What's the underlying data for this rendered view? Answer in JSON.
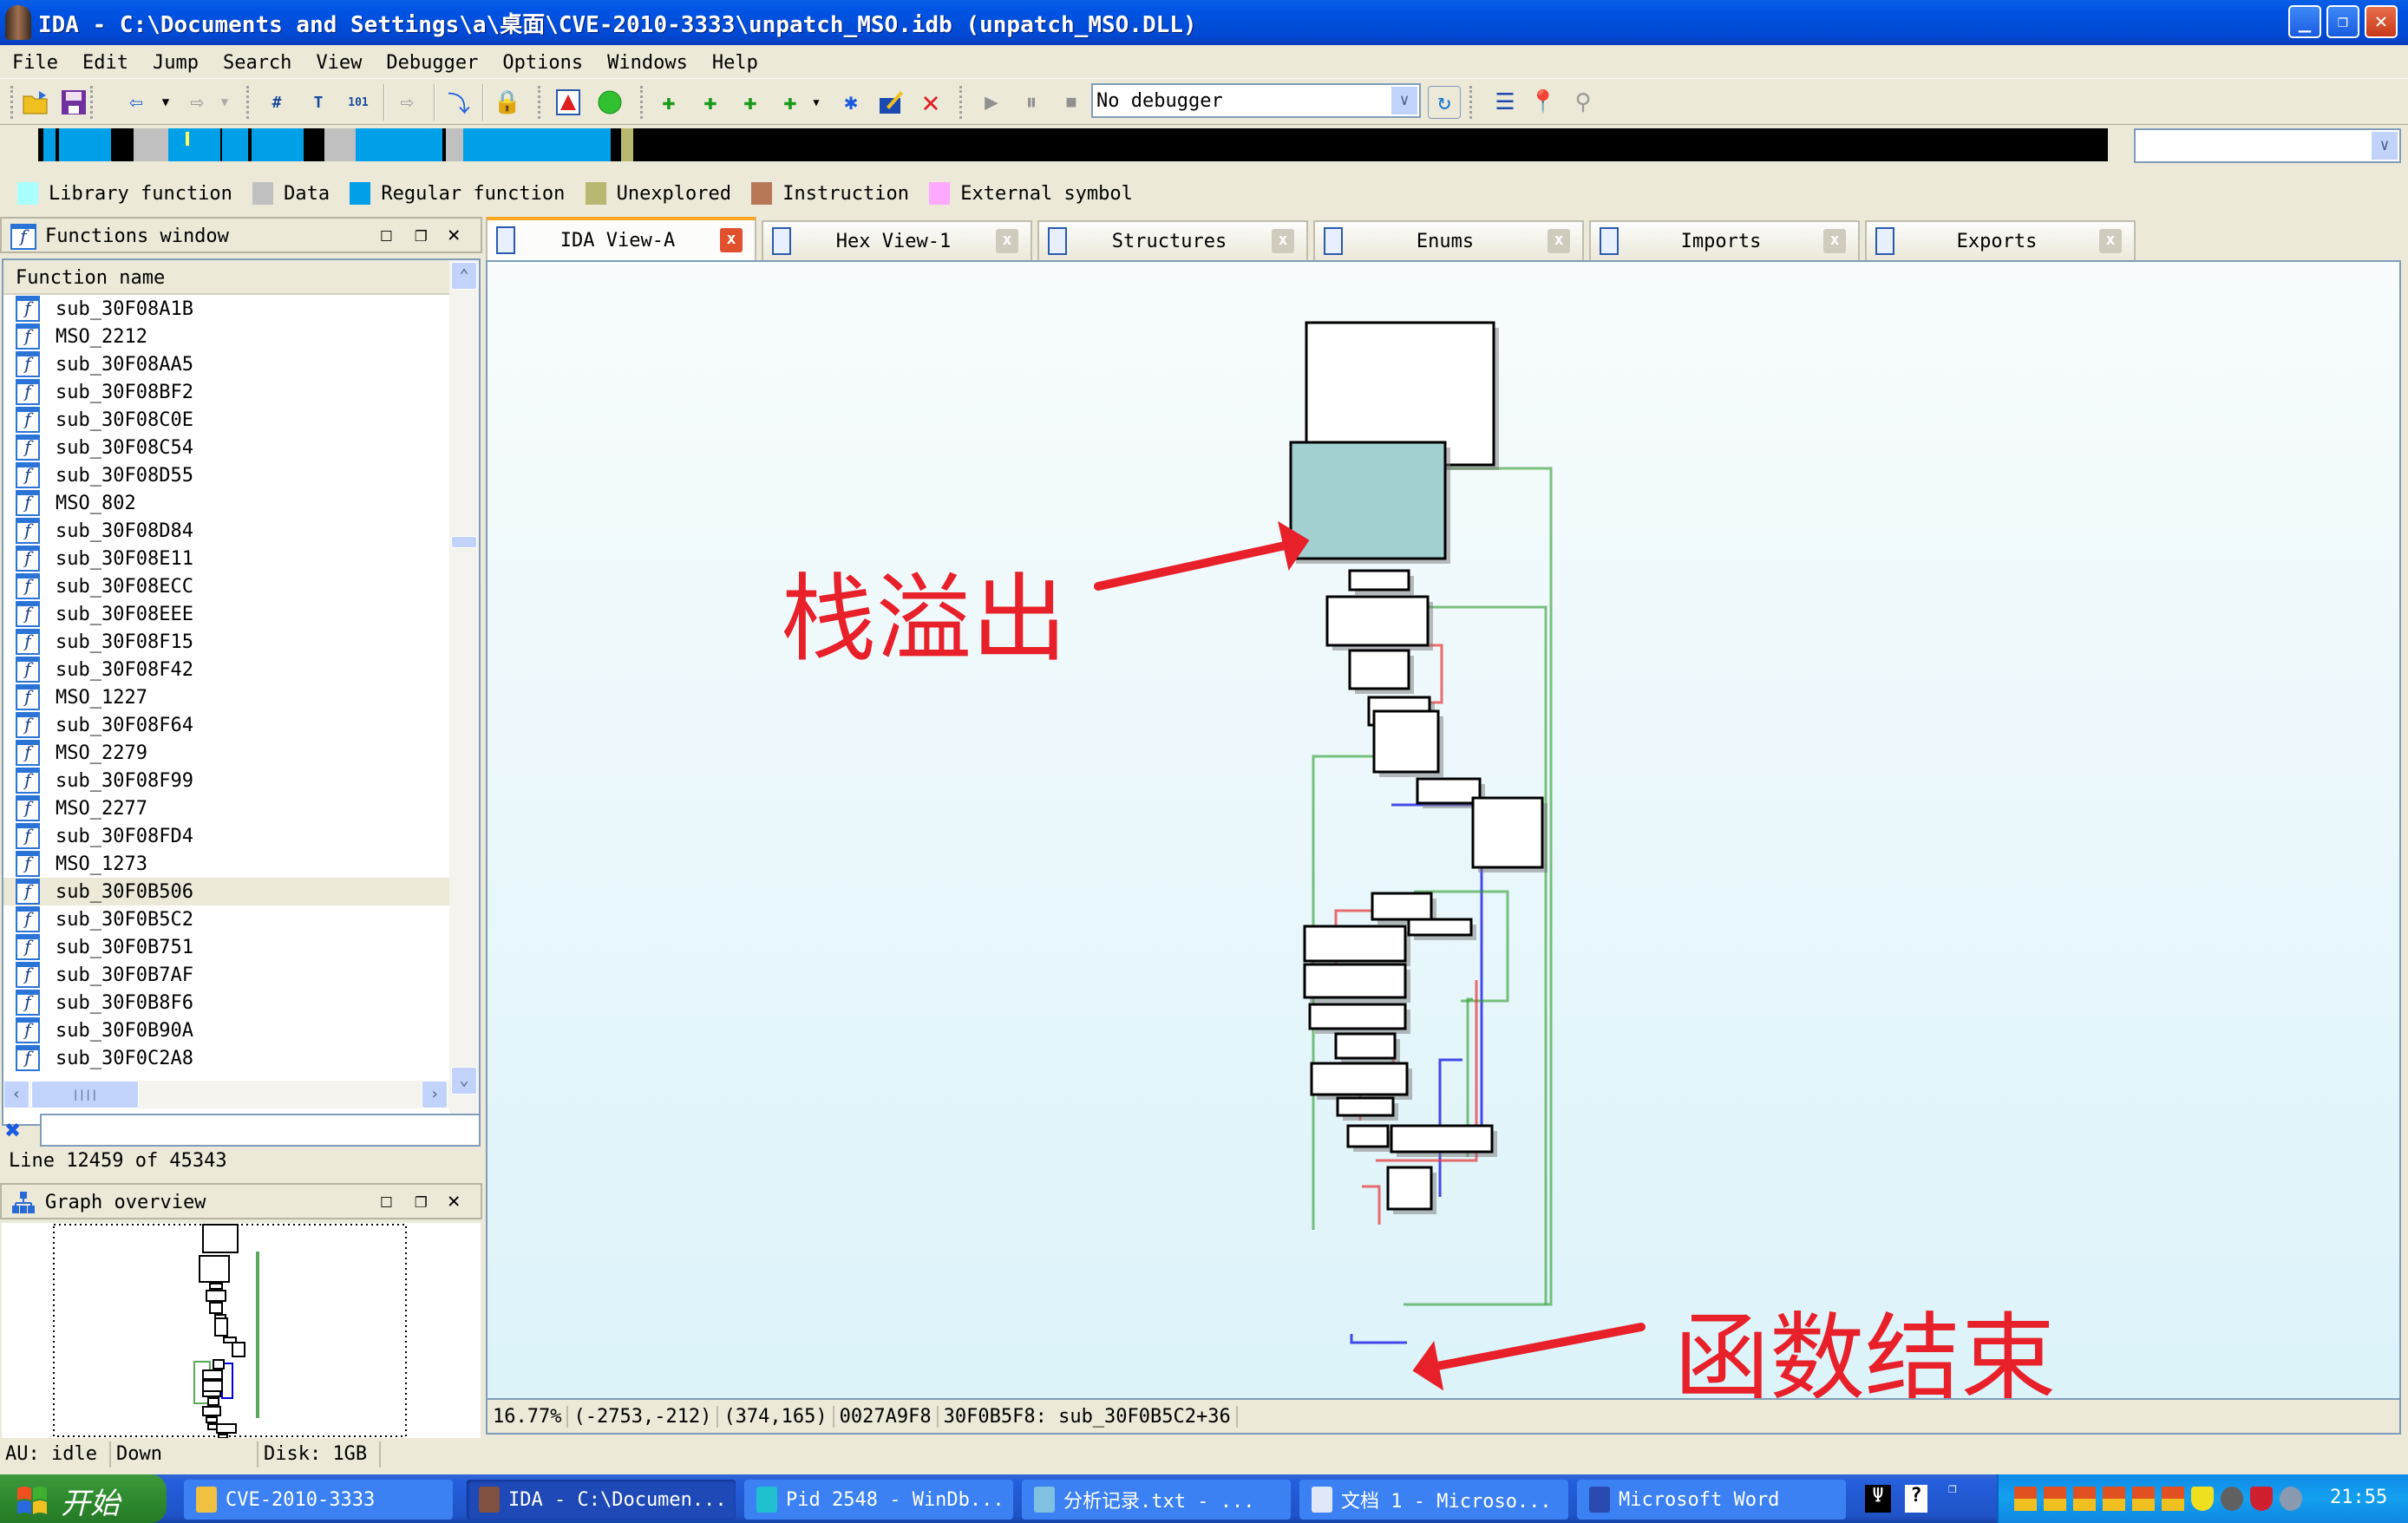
{
  "window": {
    "title": "IDA - C:\\Documents and Settings\\a\\桌面\\CVE-2010-3333\\unpatch_MSO.idb (unpatch_MSO.DLL)",
    "controls": {
      "minimize": "_",
      "restore": "❐",
      "close": "✕"
    }
  },
  "menu": [
    "File",
    "Edit",
    "Jump",
    "Search",
    "View",
    "Debugger",
    "Options",
    "Windows",
    "Help"
  ],
  "toolbar": {
    "icons": [
      "open-icon",
      "save-icon",
      "back-icon",
      "forward-icon",
      "search-hex-icon",
      "search-text-icon",
      "search-imm-icon",
      "search-next-icon",
      "jump-icon",
      "lock-icon",
      "warning-icon",
      "green-ball-icon",
      "make-code-icon",
      "make-data-icon",
      "make-ascii-icon",
      "make-string-icon",
      "make-array-icon",
      "edit-icon",
      "undefine-icon",
      "run-icon",
      "pause-icon",
      "stop-icon"
    ],
    "debugger_select": "No debugger",
    "debugger_arrow": "∨"
  },
  "nav_select_arrow": "∨",
  "legend": [
    {
      "label": "Library function",
      "color": "#aaffff"
    },
    {
      "label": "Data",
      "color": "#c0c0c0"
    },
    {
      "label": "Regular function",
      "color": "#00a0e8"
    },
    {
      "label": "Unexplored",
      "color": "#b8b870"
    },
    {
      "label": "Instruction",
      "color": "#b87858"
    },
    {
      "label": "External symbol",
      "color": "#ffa8ff"
    }
  ],
  "functions_window": {
    "title": "Functions window",
    "column_header": "Function name",
    "icon_glyph": "f",
    "items": [
      "sub_30F08A1B",
      "MSO_2212",
      "sub_30F08AA5",
      "sub_30F08BF2",
      "sub_30F08C0E",
      "sub_30F08C54",
      "sub_30F08D55",
      "MSO_802",
      "sub_30F08D84",
      "sub_30F08E11",
      "sub_30F08ECC",
      "sub_30F08EEE",
      "sub_30F08F15",
      "sub_30F08F42",
      "MSO_1227",
      "sub_30F08F64",
      "MSO_2279",
      "sub_30F08F99",
      "MSO_2277",
      "sub_30F08FD4",
      "MSO_1273",
      "sub_30F0B506",
      "sub_30F0B5C2",
      "sub_30F0B751",
      "sub_30F0B7AF",
      "sub_30F0B8F6",
      "sub_30F0B90A",
      "sub_30F0C2A8"
    ],
    "selected_index": 21,
    "line_status": "Line 12459 of 45343",
    "filter_placeholder": ""
  },
  "graph_overview": {
    "title": "Graph overview"
  },
  "panel_buttons": {
    "maximize": "☐",
    "float": "❐",
    "close": "✕"
  },
  "tabs": [
    {
      "label": "IDA View-A",
      "active": true
    },
    {
      "label": "Hex View-1",
      "active": false
    },
    {
      "label": "Structures",
      "active": false
    },
    {
      "label": "Enums",
      "active": false
    },
    {
      "label": "Imports",
      "active": false
    },
    {
      "label": "Exports",
      "active": false
    }
  ],
  "tab_close": "x",
  "graph": {
    "annotation_overflow": "栈溢出",
    "annotation_end": "函数结束",
    "highlight_color": "#a2cfd0",
    "edge_colors": {
      "true": "#2a9a2a",
      "false": "#e83030",
      "unconditional": "#0000e0"
    }
  },
  "graph_status": [
    "16.77%",
    "(-2753,-212)",
    "(374,165)",
    "0027A9F8",
    "30F0B5F8: sub_30F0B5C2+36"
  ],
  "status": {
    "au": "AU:  idle",
    "direction": "Down",
    "disk": "Disk: 1GB"
  },
  "taskbar": {
    "start": "开始",
    "buttons": [
      {
        "label": "CVE-2010-3333",
        "icon": "folder-icon",
        "active": false
      },
      {
        "label": "IDA - C:\\Documen...",
        "icon": "ida-icon",
        "active": true
      },
      {
        "label": "Pid 2548 - WinDb...",
        "icon": "windbg-icon",
        "active": false
      },
      {
        "label": "分析记录.txt - ...",
        "icon": "notepad-icon",
        "active": false
      },
      {
        "label": "文档 1 - Microso...",
        "icon": "word-doc-icon",
        "active": false
      },
      {
        "label": "Microsoft Word",
        "icon": "word-icon",
        "active": false
      }
    ],
    "clock": "21:55"
  }
}
